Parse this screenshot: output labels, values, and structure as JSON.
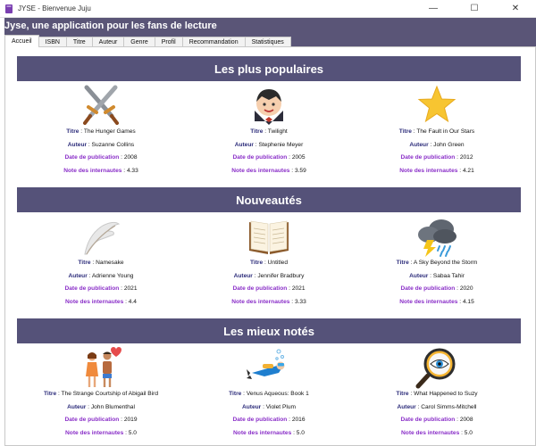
{
  "window": {
    "title": "JYSE - Bienvenue Juju",
    "controls": {
      "minimize": "—",
      "maximize": "☐",
      "close": "✕"
    }
  },
  "app": {
    "heading": "Jyse, une application pour les fans de lecture"
  },
  "tabs": [
    {
      "label": "Accueil",
      "active": true
    },
    {
      "label": "ISBN",
      "active": false
    },
    {
      "label": "Titre",
      "active": false
    },
    {
      "label": "Auteur",
      "active": false
    },
    {
      "label": "Genre",
      "active": false
    },
    {
      "label": "Profil",
      "active": false
    },
    {
      "label": "Recommandation",
      "active": false
    },
    {
      "label": "Statistiques",
      "active": false
    }
  ],
  "labels": {
    "title": "Titre",
    "author": "Auteur",
    "published": "Date de publication",
    "rating": "Note des internautes"
  },
  "sections": [
    {
      "heading": "Les plus populaires",
      "books": [
        {
          "icon": "crossed-swords-icon",
          "title": "The Hunger Games",
          "author": "Suzanne Collins",
          "date": "2008",
          "rating": "4.33"
        },
        {
          "icon": "vampire-icon",
          "title": "Twilight",
          "author": "Stephenie Meyer",
          "date": "2005",
          "rating": "3.59"
        },
        {
          "icon": "star-icon",
          "title": "The Fault in Our Stars",
          "author": "John Green",
          "date": "2012",
          "rating": "4.21"
        }
      ]
    },
    {
      "heading": "Nouveautés",
      "books": [
        {
          "icon": "feather-quill-icon",
          "title": "Namesake",
          "author": "Adrienne Young",
          "date": "2021",
          "rating": "4.4"
        },
        {
          "icon": "open-book-icon",
          "title": "Untitled",
          "author": "Jennifer Bradbury",
          "date": "2021",
          "rating": "3.33"
        },
        {
          "icon": "storm-cloud-icon",
          "title": "A Sky Beyond the Storm",
          "author": "Sabaa Tahir",
          "date": "2020",
          "rating": "4.15"
        }
      ]
    },
    {
      "heading": "Les mieux notés",
      "books": [
        {
          "icon": "couple-icon",
          "title": "The Strange Courtship of Abigail Bird",
          "author": "John Blumenthal",
          "date": "2019",
          "rating": "5.0"
        },
        {
          "icon": "diver-icon",
          "title": "Venus Aqueous: Book 1",
          "author": "Violet Plum",
          "date": "2016",
          "rating": "5.0"
        },
        {
          "icon": "magnifier-eye-icon",
          "title": "What Happened to Suzy",
          "author": "Carol Simms-Mitchell",
          "date": "2008",
          "rating": "5.0"
        }
      ]
    }
  ],
  "colors": {
    "band": "#555279",
    "background": "#5a5577",
    "label_primary": "#2c2c7a",
    "label_accent": "#8a2fc8"
  }
}
